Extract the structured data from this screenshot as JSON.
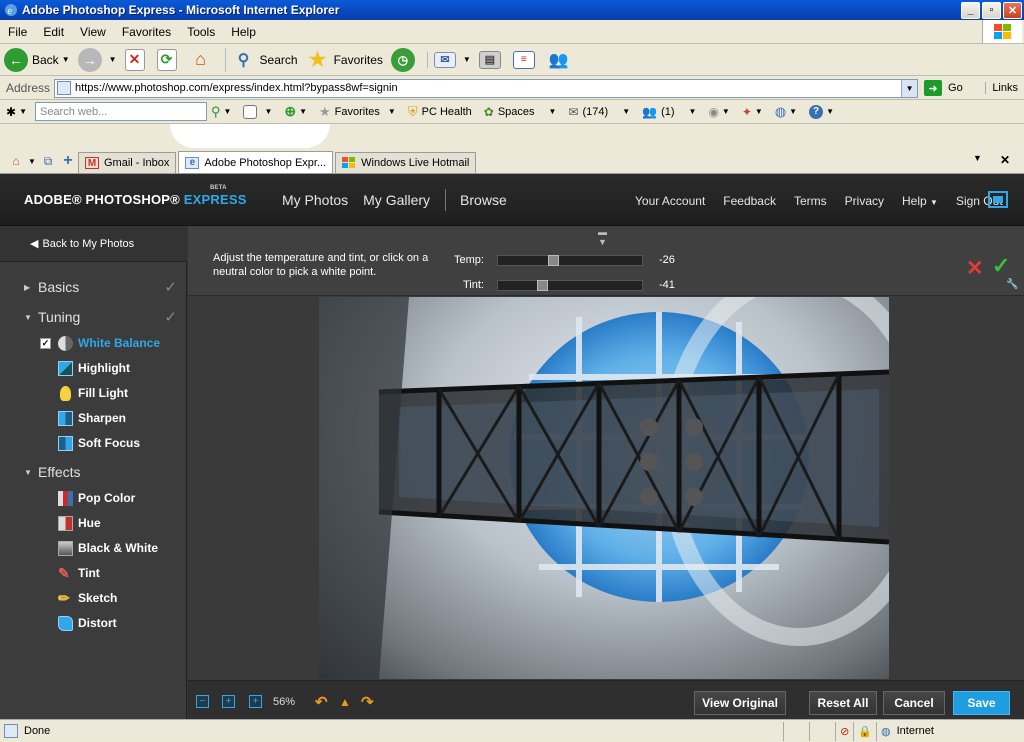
{
  "window": {
    "title": "Adobe Photoshop Express - Microsoft Internet Explorer"
  },
  "menu": [
    "File",
    "Edit",
    "View",
    "Favorites",
    "Tools",
    "Help"
  ],
  "toolbar": {
    "back": "Back",
    "search": "Search",
    "favorites": "Favorites"
  },
  "address": {
    "label": "Address",
    "url": "https://www.photoshop.com/express/index.html?bypass8wf=signin",
    "go": "Go",
    "links": "Links"
  },
  "livebar": {
    "search_placeholder": "Search web...",
    "favorites": "Favorites",
    "pchealth": "PC Health",
    "spaces": "Spaces",
    "mail_count": "(174)",
    "contacts_count": "(1)"
  },
  "tabs": [
    {
      "label": "Gmail - Inbox"
    },
    {
      "label": "Adobe Photoshop Expr..."
    },
    {
      "label": "Windows Live Hotmail"
    }
  ],
  "app": {
    "logo": {
      "part1": "ADOBE® PHOTOSHOP®",
      "part2": "EXPRESS",
      "beta": "BETA"
    },
    "nav": [
      "My Photos",
      "My Gallery",
      "Browse"
    ],
    "user_nav": [
      "Your Account",
      "Feedback",
      "Terms",
      "Privacy",
      "Help",
      "Sign Out"
    ],
    "back_link": "Back to My Photos",
    "sections": {
      "basics": "Basics",
      "tuning": "Tuning",
      "effects": "Effects"
    },
    "tuning_tools": [
      "White Balance",
      "Highlight",
      "Fill Light",
      "Sharpen",
      "Soft Focus"
    ],
    "effects_tools": [
      "Pop Color",
      "Hue",
      "Black & White",
      "Tint",
      "Sketch",
      "Distort"
    ],
    "adjust": {
      "instruction": "Adjust the temperature and tint, or click on a neutral color to pick a white point.",
      "temp_label": "Temp:",
      "temp_value": "-26",
      "tint_label": "Tint:",
      "tint_value": "-41",
      "temp_level": 0.37,
      "tint_level": 0.29
    },
    "zoom": "56%",
    "buttons": {
      "view_original": "View Original",
      "reset_all": "Reset All",
      "cancel": "Cancel",
      "save": "Save"
    }
  },
  "status": {
    "done": "Done",
    "zone": "Internet"
  },
  "colors": {
    "accent": "#2fa8e8",
    "save": "#1e9ee0",
    "ok": "#35c23a",
    "cancel": "#e23a3a"
  }
}
